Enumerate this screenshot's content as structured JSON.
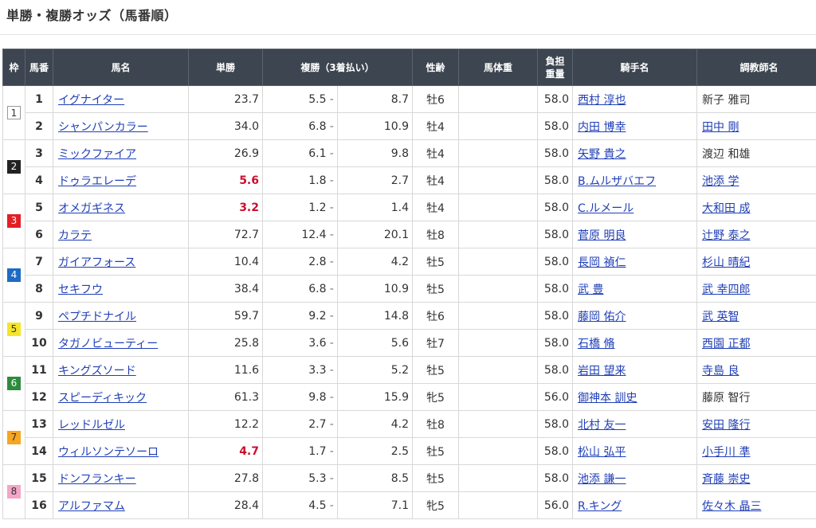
{
  "page": {
    "title": "単勝・複勝オッズ（馬番順）"
  },
  "headers": {
    "waku": "枠",
    "umaban": "馬番",
    "name": "馬名",
    "win": "単勝",
    "place": "複勝（3着払い）",
    "sexage": "性齢",
    "bodyweight": "馬体重",
    "burden_line1": "負担",
    "burden_line2": "重量",
    "jockey": "騎手名",
    "trainer": "調教師名"
  },
  "waku_colors": {
    "1": "#ffffff",
    "2": "#222222",
    "3": "#e31f26",
    "4": "#1d6bc4",
    "5": "#f5e52a",
    "6": "#2e8b3d",
    "7": "#f5a623",
    "8": "#f3a6c8"
  },
  "rows": [
    {
      "waku": "1",
      "num": "1",
      "name": "イグナイター",
      "win": "23.7",
      "hot": false,
      "pmin": "5.5",
      "pmax": "8.7",
      "sex": "牡6",
      "bw": "",
      "wt": "58.0",
      "jockey": "西村 淳也",
      "trainer": "新子 雅司",
      "trainer_link": false
    },
    {
      "waku": "1",
      "num": "2",
      "name": "シャンパンカラー",
      "win": "34.0",
      "hot": false,
      "pmin": "6.8",
      "pmax": "10.9",
      "sex": "牡4",
      "bw": "",
      "wt": "58.0",
      "jockey": "内田 博幸",
      "trainer": "田中 剛",
      "trainer_link": true
    },
    {
      "waku": "2",
      "num": "3",
      "name": "ミックファイア",
      "win": "26.9",
      "hot": false,
      "pmin": "6.1",
      "pmax": "9.8",
      "sex": "牡4",
      "bw": "",
      "wt": "58.0",
      "jockey": "矢野 貴之",
      "trainer": "渡辺 和雄",
      "trainer_link": false
    },
    {
      "waku": "2",
      "num": "4",
      "name": "ドゥラエレーデ",
      "win": "5.6",
      "hot": true,
      "pmin": "1.8",
      "pmax": "2.7",
      "sex": "牡4",
      "bw": "",
      "wt": "58.0",
      "jockey": "B.ムルザバエフ",
      "trainer": "池添 学",
      "trainer_link": true
    },
    {
      "waku": "3",
      "num": "5",
      "name": "オメガギネス",
      "win": "3.2",
      "hot": true,
      "pmin": "1.2",
      "pmax": "1.4",
      "sex": "牡4",
      "bw": "",
      "wt": "58.0",
      "jockey": "C.ルメール",
      "trainer": "大和田 成",
      "trainer_link": true
    },
    {
      "waku": "3",
      "num": "6",
      "name": "カラテ",
      "win": "72.7",
      "hot": false,
      "pmin": "12.4",
      "pmax": "20.1",
      "sex": "牡8",
      "bw": "",
      "wt": "58.0",
      "jockey": "菅原 明良",
      "trainer": "辻野 泰之",
      "trainer_link": true
    },
    {
      "waku": "4",
      "num": "7",
      "name": "ガイアフォース",
      "win": "10.4",
      "hot": false,
      "pmin": "2.8",
      "pmax": "4.2",
      "sex": "牡5",
      "bw": "",
      "wt": "58.0",
      "jockey": "長岡 禎仁",
      "trainer": "杉山 晴紀",
      "trainer_link": true
    },
    {
      "waku": "4",
      "num": "8",
      "name": "セキフウ",
      "win": "38.4",
      "hot": false,
      "pmin": "6.8",
      "pmax": "10.9",
      "sex": "牡5",
      "bw": "",
      "wt": "58.0",
      "jockey": "武 豊",
      "trainer": "武 幸四郎",
      "trainer_link": true
    },
    {
      "waku": "5",
      "num": "9",
      "name": "ペプチドナイル",
      "win": "59.7",
      "hot": false,
      "pmin": "9.2",
      "pmax": "14.8",
      "sex": "牡6",
      "bw": "",
      "wt": "58.0",
      "jockey": "藤岡 佑介",
      "trainer": "武 英智",
      "trainer_link": true
    },
    {
      "waku": "5",
      "num": "10",
      "name": "タガノビューティー",
      "win": "25.8",
      "hot": false,
      "pmin": "3.6",
      "pmax": "5.6",
      "sex": "牡7",
      "bw": "",
      "wt": "58.0",
      "jockey": "石橋 脩",
      "trainer": "西園 正都",
      "trainer_link": true
    },
    {
      "waku": "6",
      "num": "11",
      "name": "キングズソード",
      "win": "11.6",
      "hot": false,
      "pmin": "3.3",
      "pmax": "5.2",
      "sex": "牡5",
      "bw": "",
      "wt": "58.0",
      "jockey": "岩田 望来",
      "trainer": "寺島 良",
      "trainer_link": true
    },
    {
      "waku": "6",
      "num": "12",
      "name": "スピーディキック",
      "win": "61.3",
      "hot": false,
      "pmin": "9.8",
      "pmax": "15.9",
      "sex": "牝5",
      "bw": "",
      "wt": "56.0",
      "jockey": "御神本 訓史",
      "trainer": "藤原 智行",
      "trainer_link": false
    },
    {
      "waku": "7",
      "num": "13",
      "name": "レッドルゼル",
      "win": "12.2",
      "hot": false,
      "pmin": "2.7",
      "pmax": "4.2",
      "sex": "牡8",
      "bw": "",
      "wt": "58.0",
      "jockey": "北村 友一",
      "trainer": "安田 隆行",
      "trainer_link": true
    },
    {
      "waku": "7",
      "num": "14",
      "name": "ウィルソンテソーロ",
      "win": "4.7",
      "hot": true,
      "pmin": "1.7",
      "pmax": "2.5",
      "sex": "牡5",
      "bw": "",
      "wt": "58.0",
      "jockey": "松山 弘平",
      "trainer": "小手川 準",
      "trainer_link": true
    },
    {
      "waku": "8",
      "num": "15",
      "name": "ドンフランキー",
      "win": "27.8",
      "hot": false,
      "pmin": "5.3",
      "pmax": "8.5",
      "sex": "牡5",
      "bw": "",
      "wt": "58.0",
      "jockey": "池添 謙一",
      "trainer": "斉藤 崇史",
      "trainer_link": true
    },
    {
      "waku": "8",
      "num": "16",
      "name": "アルファマム",
      "win": "28.4",
      "hot": false,
      "pmin": "4.5",
      "pmax": "7.1",
      "sex": "牝5",
      "bw": "",
      "wt": "56.0",
      "jockey": "R.キング",
      "trainer": "佐々木 晶三",
      "trainer_link": true
    }
  ],
  "dash": "-"
}
